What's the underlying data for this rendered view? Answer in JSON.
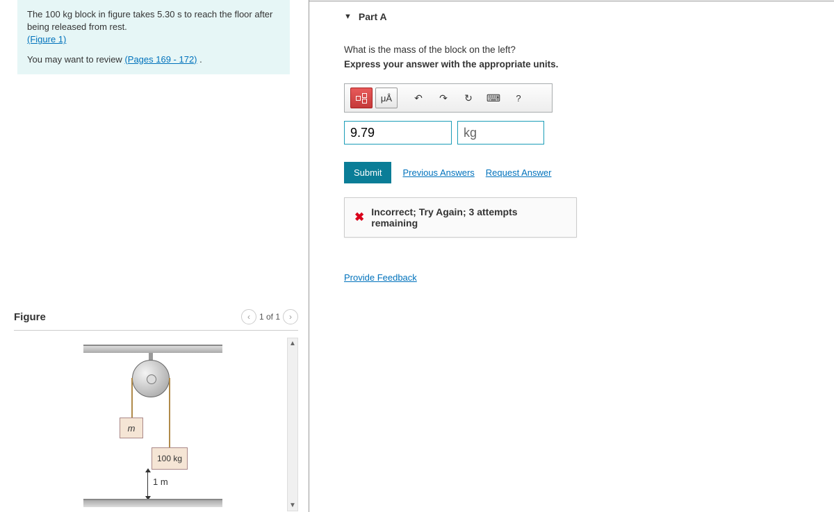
{
  "problem": {
    "text_1": "The 100 kg block in figure takes 5.30 s to reach the floor after being released from rest.",
    "figure_link": "(Figure 1)",
    "review_prefix": "You may want to review ",
    "review_link": "(Pages 169 - 172)",
    "review_suffix": " ."
  },
  "figure": {
    "title": "Figure",
    "pager": "1 of 1",
    "left_block": "m",
    "right_block": "100 kg",
    "dimension": "1 m"
  },
  "part": {
    "label": "Part A",
    "question": "What is the mass of the block on the left?",
    "express": "Express your answer with the appropriate units."
  },
  "toolbar": {
    "units_btn": "μÅ",
    "help": "?"
  },
  "answer": {
    "value": "9.79",
    "unit": "kg"
  },
  "actions": {
    "submit": "Submit",
    "previous": "Previous Answers",
    "request": "Request Answer"
  },
  "feedback": {
    "message": "Incorrect; Try Again; 3 attempts remaining"
  },
  "links": {
    "provide_feedback": "Provide Feedback"
  }
}
